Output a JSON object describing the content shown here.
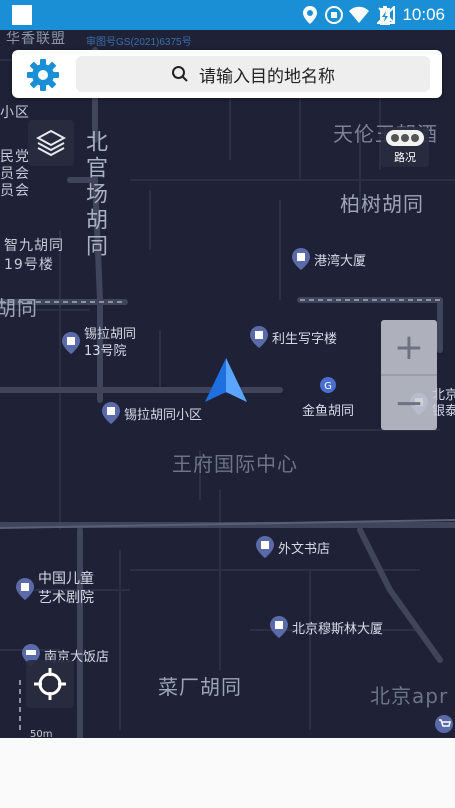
{
  "status_bar": {
    "time": "10:06"
  },
  "search": {
    "placeholder": "请输入目的地名称"
  },
  "map": {
    "copyright": "审图号GS(2021)6375号",
    "traffic_label": "路况",
    "zoom_in": "+",
    "zoom_out": "−",
    "scale": "50m",
    "street_labels": [
      "北官场胡同",
      "天伦王朝酒",
      "柏树胡同",
      "王府国际中心",
      "菜厂胡同",
      "北京apr",
      "胡同"
    ],
    "left_fragments": [
      "小区",
      "民党",
      "员会",
      "员会",
      "智九胡同",
      "19号楼"
    ],
    "top_fragment": "华香联盟",
    "pois": [
      {
        "name": "港湾大厦"
      },
      {
        "name": "锡拉胡同\n13号院"
      },
      {
        "name": "利生写字楼"
      },
      {
        "name": "锡拉胡同小区"
      },
      {
        "name": "金鱼胡同"
      },
      {
        "name": "北京\n银泰"
      },
      {
        "name": "外文书店"
      },
      {
        "name": "中国儿童\n艺术剧院"
      },
      {
        "name": "北京穆斯林大厦"
      },
      {
        "name": "南京大饭店"
      }
    ]
  },
  "colors": {
    "status_bar": "#1a8fd6",
    "map_bg": "#1f2236",
    "accent": "#1a8fd6"
  }
}
